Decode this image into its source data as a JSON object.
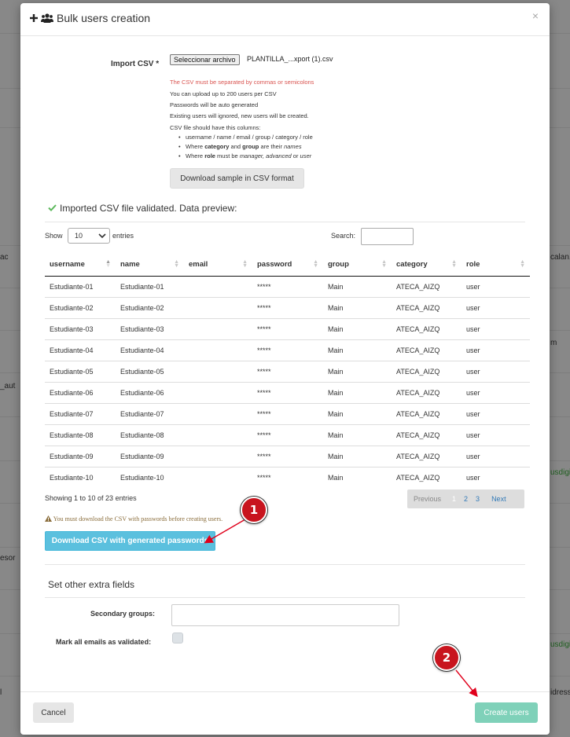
{
  "background": {
    "texts": [
      "ac",
      "calan.c",
      "m",
      "_aut",
      "esor",
      "usdigi",
      "usdigi",
      "l",
      "idress"
    ]
  },
  "modal": {
    "title": "Bulk users creation",
    "close": "×",
    "import": {
      "label": "Import CSV *",
      "file_button": "Seleccionar archivo",
      "file_name": "PLANTILLA_...xport (1).csv"
    },
    "help": {
      "separator": "The CSV must be separated by commas or semicolons",
      "limit": "You can upload up to 200 users per CSV",
      "passwords": "Passwords will be auto generated",
      "existing": "Existing users will ignored, new users will be created.",
      "columns_intro": "CSV file should have this columns:",
      "bullet_1": "username / name / email / group / category / role",
      "bullet_2_a": "Where ",
      "bullet_2_b": "category",
      "bullet_2_c": " and ",
      "bullet_2_d": "group",
      "bullet_2_e": " are their ",
      "bullet_2_f": "names",
      "bullet_3_a": "Where ",
      "bullet_3_b": "role",
      "bullet_3_c": " must be ",
      "bullet_3_d": "manager, advanced",
      "bullet_3_e": " or ",
      "bullet_3_f": "user"
    },
    "sample_button": "Download sample in CSV format",
    "validated_text": "Imported CSV file validated. Data preview:",
    "table_controls": {
      "show": "Show",
      "length": "10",
      "entries": "entries",
      "search": "Search:"
    },
    "table": {
      "columns": [
        "username",
        "name",
        "email",
        "password",
        "group",
        "category",
        "role"
      ],
      "rows": [
        [
          "Estudiante-01",
          "Estudiante-01",
          "",
          "*****",
          "Main",
          "ATECA_AIZQ",
          "user"
        ],
        [
          "Estudiante-02",
          "Estudiante-02",
          "",
          "*****",
          "Main",
          "ATECA_AIZQ",
          "user"
        ],
        [
          "Estudiante-03",
          "Estudiante-03",
          "",
          "*****",
          "Main",
          "ATECA_AIZQ",
          "user"
        ],
        [
          "Estudiante-04",
          "Estudiante-04",
          "",
          "*****",
          "Main",
          "ATECA_AIZQ",
          "user"
        ],
        [
          "Estudiante-05",
          "Estudiante-05",
          "",
          "*****",
          "Main",
          "ATECA_AIZQ",
          "user"
        ],
        [
          "Estudiante-06",
          "Estudiante-06",
          "",
          "*****",
          "Main",
          "ATECA_AIZQ",
          "user"
        ],
        [
          "Estudiante-07",
          "Estudiante-07",
          "",
          "*****",
          "Main",
          "ATECA_AIZQ",
          "user"
        ],
        [
          "Estudiante-08",
          "Estudiante-08",
          "",
          "*****",
          "Main",
          "ATECA_AIZQ",
          "user"
        ],
        [
          "Estudiante-09",
          "Estudiante-09",
          "",
          "*****",
          "Main",
          "ATECA_AIZQ",
          "user"
        ],
        [
          "Estudiante-10",
          "Estudiante-10",
          "",
          "*****",
          "Main",
          "ATECA_AIZQ",
          "user"
        ]
      ]
    },
    "info": "Showing 1 to 10 of 23 entries",
    "pagination": {
      "previous": "Previous",
      "pages": [
        "1",
        "2",
        "3"
      ],
      "next": "Next"
    },
    "warning": "You must download the CSV with passwords before creating users.",
    "download_button": "Download CSV with generated passwords",
    "extra_title": "Set other extra fields",
    "secondary_groups_label": "Secondary groups:",
    "mark_validated_label": "Mark all emails as validated:",
    "cancel_button": "Cancel",
    "create_button": "Create users"
  },
  "annotations": {
    "marker_1": "1",
    "marker_2": "2"
  },
  "colors": {
    "accent_info": "#5bc0de",
    "success_button": "#7fd1b9",
    "marker": "#c8141e",
    "error_text": "#d9534f",
    "warning_text": "#8a6d3b"
  }
}
